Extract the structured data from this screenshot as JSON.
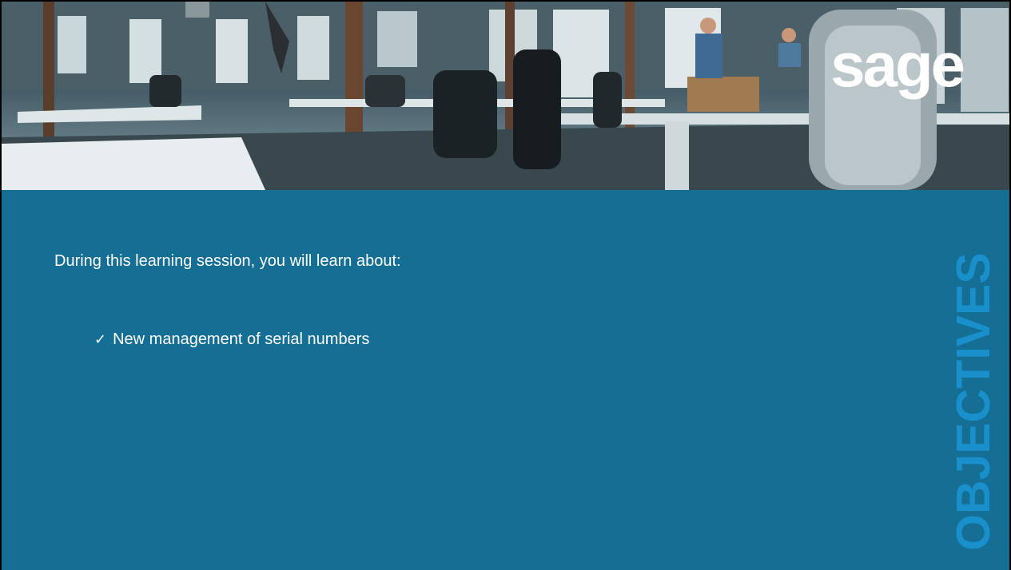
{
  "header": {
    "logo_text": "sage",
    "photo_alt": "office-photo"
  },
  "content": {
    "intro": "During this learning session, you will learn about:",
    "bullets": [
      {
        "check": "✓",
        "text": "New management of serial numbers"
      }
    ]
  },
  "side_title": "OBJECTIVES",
  "colors": {
    "panel": "#156e94",
    "side_title": "#1990cc",
    "text": "#ffffff",
    "logo": "#ffffff"
  }
}
